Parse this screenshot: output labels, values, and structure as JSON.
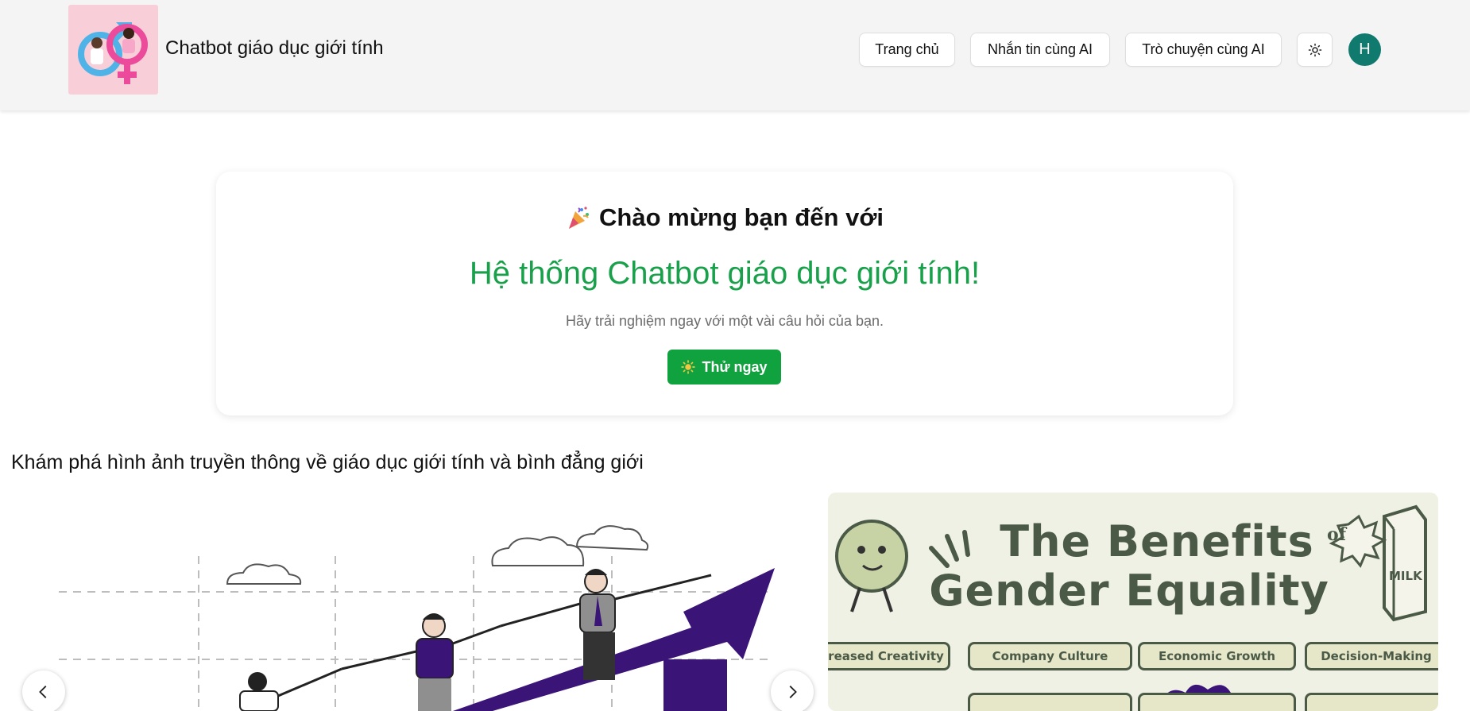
{
  "header": {
    "app_title": "Chatbot giáo dục giới tính",
    "nav": {
      "home": "Trang chủ",
      "message_ai": "Nhắn tin cùng AI",
      "talk_ai": "Trò chuyện cùng AI"
    },
    "theme_icon": "sun-icon",
    "avatar_letter": "H"
  },
  "welcome": {
    "icon": "party-popper-icon",
    "title": "Chào mừng bạn đến với",
    "subtitle": "Hệ thống Chatbot giáo dục giới tính!",
    "description": "Hãy trải nghiệm ngay với một vài câu hỏi của bạn.",
    "button_label": "Thử ngay",
    "button_icon": "sun-icon"
  },
  "section": {
    "title": "Khám phá hình ảnh truyền thông về giáo dục giới tính và bình đẳng giới"
  },
  "carousel": {
    "right_slide": {
      "title_line1": "The Benefits",
      "badge": "of",
      "title_line2": "Gender Equality",
      "milk_label": "MILK",
      "pills": [
        "reased Creativity",
        "Company Culture",
        "Economic Growth",
        "Decision-Making"
      ]
    }
  },
  "colors": {
    "accent_green": "#18a04a",
    "button_green": "#10a23e",
    "avatar_teal": "#117a6f",
    "header_bg": "#f4f4f4",
    "illustration_purple": "#3b1478"
  }
}
